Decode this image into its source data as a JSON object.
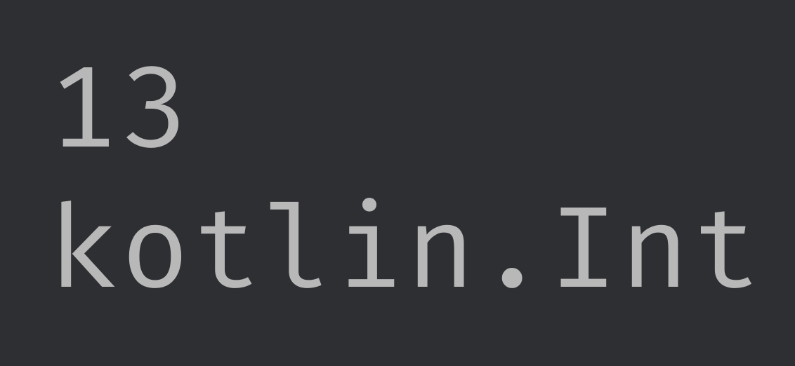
{
  "output": {
    "value": "13",
    "type": "kotlin.Int"
  },
  "colors": {
    "background": "#2e2f33",
    "text": "#b8b8b8"
  }
}
